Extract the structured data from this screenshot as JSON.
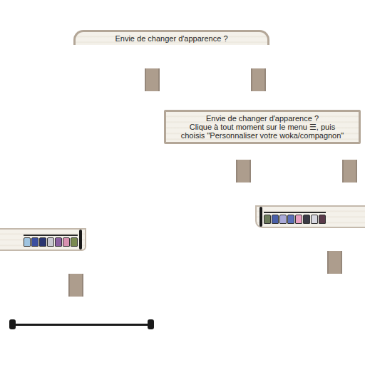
{
  "signs": [
    {
      "lines": [
        "Envie de changer d'apparence ?"
      ]
    },
    {
      "lines": [
        "Envie de changer d'apparence ?",
        "Clique à tout moment sur le menu ☰, puis",
        "choisis \"Personnaliser votre woka/compagnon\""
      ]
    }
  ],
  "racks": [
    {
      "clothes": [
        {
          "color": "#6b7a5a"
        },
        {
          "color": "#4a5fa8"
        },
        {
          "color": "#a9a9d8"
        },
        {
          "color": "#5a6fb8"
        },
        {
          "color": "#e8a0c0"
        },
        {
          "color": "#3a3a44"
        },
        {
          "color": "#d8d8e0"
        },
        {
          "color": "#5a3a4a"
        }
      ]
    },
    {
      "clothes": [
        {
          "color": "#9fc4e0"
        },
        {
          "color": "#3b4fa0"
        },
        {
          "color": "#2a3570"
        },
        {
          "color": "#c8c8d0"
        },
        {
          "color": "#8a5fa0"
        },
        {
          "color": "#d890b0"
        },
        {
          "color": "#7a8a50"
        }
      ]
    }
  ]
}
